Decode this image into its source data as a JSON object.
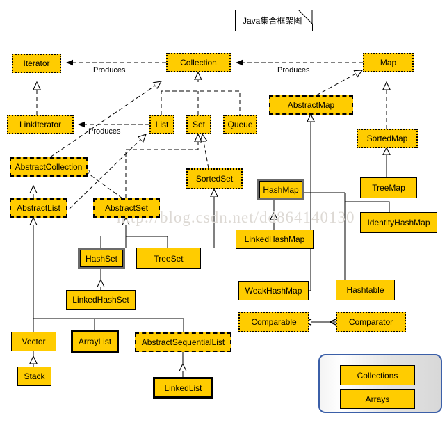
{
  "title_note": {
    "text": "Java集合框架图"
  },
  "watermark": {
    "text": "http://blog.csdn.net/dd864140130"
  },
  "edge_labels": [
    {
      "text": "Produces"
    },
    {
      "text": "Produces"
    },
    {
      "text": "Produces"
    }
  ],
  "nodes": {
    "iterator": "Iterator",
    "link_iterator": "LinkIterator",
    "collection": "Collection",
    "map": "Map",
    "list": "List",
    "set": "Set",
    "queue": "Queue",
    "abstract_map": "AbstractMap",
    "sorted_map": "SortedMap",
    "abstract_collection": "AbstractCollection",
    "sorted_set": "SortedSet",
    "hash_map": "HashMap",
    "tree_map": "TreeMap",
    "abstract_list": "AbstractList",
    "abstract_set": "AbstractSet",
    "identity_hash_map": "IdentityHashMap",
    "linked_hash_map": "LinkedHashMap",
    "hash_set": "HashSet",
    "tree_set": "TreeSet",
    "linked_hash_set": "LinkedHashSet",
    "weak_hash_map": "WeakHashMap",
    "hashtable": "Hashtable",
    "comparable": "Comparable",
    "comparator": "Comparator",
    "vector": "Vector",
    "array_list": "ArrayList",
    "abstract_sequential_list": "AbstractSequentialList",
    "stack": "Stack",
    "linked_list": "LinkedList",
    "collections": "Collections",
    "arrays": "Arrays"
  },
  "colors": {
    "node_fill": "#FFCC00",
    "border": "#000000",
    "panel_border": "#3b5fa8",
    "highlight_border": "#6b6b6b",
    "watermark": "#ddd9d4"
  }
}
